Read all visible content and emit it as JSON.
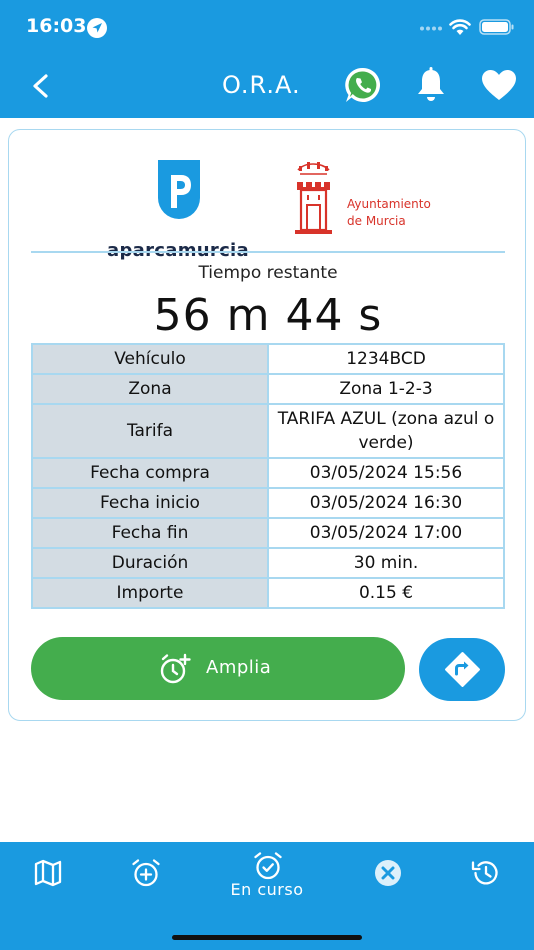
{
  "status_bar": {
    "time": "16:03"
  },
  "nav": {
    "title": "O.R.A.",
    "icons": [
      "back-chevron-icon",
      "whatsapp-icon",
      "bell-icon",
      "heart-icon"
    ]
  },
  "logos": {
    "left_text": "aparcamurcia",
    "right_line1": "Ayuntamiento",
    "right_line2": "de Murcia"
  },
  "timer": {
    "label": "Tiempo restante",
    "value": "56 m 44 s"
  },
  "details": {
    "rows": [
      {
        "label": "Vehículo",
        "value": "1234BCD"
      },
      {
        "label": "Zona",
        "value": "Zona 1-2-3"
      },
      {
        "label": "Tarifa",
        "value": "TARIFA AZUL (zona azul o verde)"
      },
      {
        "label": "Fecha compra",
        "value": "03/05/2024 15:56"
      },
      {
        "label": "Fecha inicio",
        "value": "03/05/2024 16:30"
      },
      {
        "label": "Fecha fin",
        "value": "03/05/2024 17:00"
      },
      {
        "label": "Duración",
        "value": "30 min."
      },
      {
        "label": "Importe",
        "value": "0.15 €"
      }
    ]
  },
  "actions": {
    "amplia_label": "Amplia"
  },
  "tabbar": {
    "active_label": "En curso",
    "icons": [
      "map-icon",
      "alarm-add-icon",
      "alarm-check-icon",
      "cancel-icon",
      "history-icon"
    ]
  },
  "colors": {
    "primary_blue": "#1a9ae0",
    "green": "#44ad4d",
    "border_light_blue": "#a8d8f0",
    "label_cell_gray": "#d3dce3",
    "ayuntamiento_red": "#d8332a",
    "aparca_navy": "#1b2a48"
  }
}
